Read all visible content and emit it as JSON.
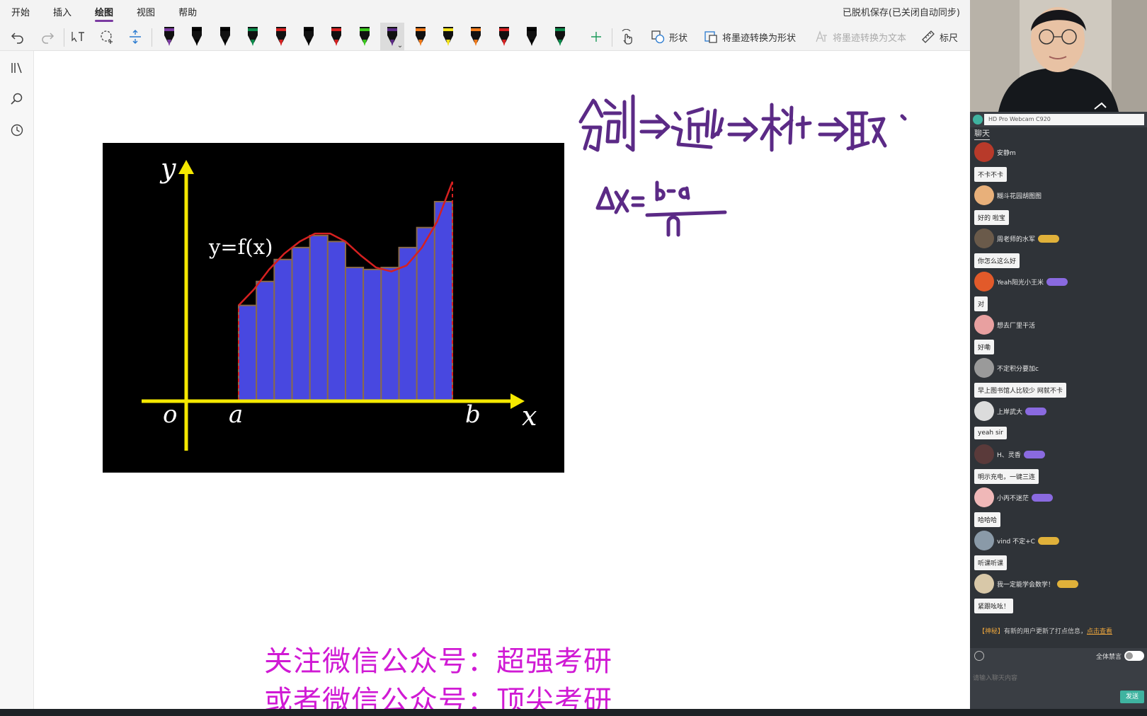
{
  "menu": {
    "tabs": [
      {
        "label": "开始"
      },
      {
        "label": "插入"
      },
      {
        "label": "绘图",
        "active": true
      },
      {
        "label": "视图"
      },
      {
        "label": "帮助"
      }
    ],
    "save_status": "已脱机保存(已关闭自动同步)"
  },
  "toolbar": {
    "pens": [
      {
        "color": "#7a3aa1"
      },
      {
        "color": "#000000"
      },
      {
        "color": "#000000"
      },
      {
        "color": "#0a8a4a"
      },
      {
        "color": "#d62020"
      },
      {
        "color": "#000000"
      },
      {
        "color": "#d62020"
      },
      {
        "color": "#39c81c"
      },
      {
        "color": "#5b2a86",
        "selected": true
      },
      {
        "color": "#f07a1a"
      },
      {
        "color": "#f2e21a"
      },
      {
        "color": "#f07a1a"
      },
      {
        "color": "#d62020"
      },
      {
        "color": "#000000"
      },
      {
        "color": "#0a8a4a"
      }
    ],
    "shape_label": "形状",
    "ink_to_shape_label": "将墨迹转换为形状",
    "ink_to_text_label": "将墨迹转换为文本",
    "ruler_label": "标尺"
  },
  "figure": {
    "func_label": "y=f(x)",
    "y_label": "y",
    "x_label": "x",
    "origin_label": "o",
    "a_label": "a",
    "b_label": "b"
  },
  "chart_data": {
    "type": "bar",
    "values": [
      0.48,
      0.6,
      0.71,
      0.77,
      0.83,
      0.8,
      0.67,
      0.66,
      0.67,
      0.77,
      0.87,
      1.0
    ],
    "curve_y": [
      0.48,
      0.56,
      0.66,
      0.74,
      0.8,
      0.84,
      0.84,
      0.8,
      0.73,
      0.67,
      0.65,
      0.68,
      0.77,
      0.9,
      1.1
    ]
  },
  "promo": {
    "line1": "关注微信公众号：超强考研",
    "line2": "或者微信公众号：顶尖考研"
  },
  "webcam": {
    "device": "HD Pro Webcam C920"
  },
  "chat": {
    "tab_label": "聊天",
    "entries": [
      {
        "user": "安静m",
        "avatar": "#b83a2a",
        "badge": "",
        "badge_color": "",
        "msg": "不卡不卡"
      },
      {
        "user": "糊斗花园胡图图",
        "avatar": "#e8b07a",
        "badge": "",
        "badge_color": "",
        "msg": "好的 啦宝"
      },
      {
        "user": "周老师的水军",
        "avatar": "#6a5a4a",
        "badge": "",
        "badge_color": "#e0b13a",
        "msg": "你怎么这么好"
      },
      {
        "user": "Yeah阳光小王米",
        "avatar": "#e25a2a",
        "badge": "",
        "badge_color": "#8a6ae0",
        "msg": "对"
      },
      {
        "user": "想去厂里干活",
        "avatar": "#e8a0a0",
        "badge": "",
        "badge_color": "",
        "msg": "好嘞"
      },
      {
        "user": "不定积分要加c",
        "avatar": "#9a9a9a",
        "badge": "",
        "badge_color": "",
        "msg": "早上图书馆人比较少 网就不卡"
      },
      {
        "user": "上岸武大",
        "avatar": "#dcdcdc",
        "badge": "",
        "badge_color": "#8a6ae0",
        "msg": "yeah sir"
      },
      {
        "user": "H、灵香",
        "avatar": "#5a3a3a",
        "badge": "",
        "badge_color": "#8a6ae0",
        "msg": "明示充电，一键三连"
      },
      {
        "user": "小丙不迷茫",
        "avatar": "#f0b8b8",
        "badge": "",
        "badge_color": "#8a6ae0",
        "msg": "哈哈哈"
      },
      {
        "user": "vind 不定+C",
        "avatar": "#8a9aa8",
        "badge": "",
        "badge_color": "#e0b13a",
        "msg": "听课听课"
      },
      {
        "user": "我一定能学会数学！",
        "avatar": "#d8c8a8",
        "badge": "",
        "badge_color": "#e0b13a",
        "msg": "紧跟吆吆！"
      }
    ],
    "system_note_tag": "【神秘】",
    "system_note": "有新的用户更新了打点信息，",
    "system_note_link": "点击查看",
    "mute_all_label": "全体禁言",
    "input_placeholder": "请输入聊天内容",
    "send_label": "发送"
  }
}
